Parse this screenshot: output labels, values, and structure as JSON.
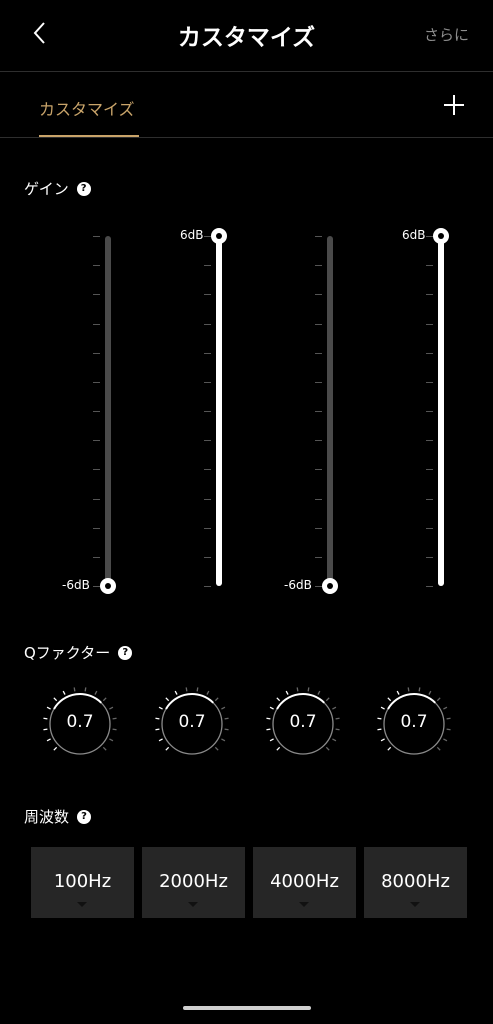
{
  "header": {
    "title": "カスタマイズ",
    "more_label": "さらに",
    "back_icon": "chevron-left-icon"
  },
  "tabs": [
    {
      "label": "カスタマイズ",
      "active": true
    }
  ],
  "colors": {
    "accent": "#c9a46a",
    "background": "#000000",
    "button_bg": "#262626"
  },
  "gain": {
    "label": "ゲイン",
    "max_label": "6dB",
    "min_label": "-6dB",
    "sliders": [
      {
        "value_db": -6
      },
      {
        "value_db": 6
      },
      {
        "value_db": -6
      },
      {
        "value_db": 6
      }
    ]
  },
  "q_factor": {
    "label": "Qファクター",
    "dials": [
      {
        "value": "0.7"
      },
      {
        "value": "0.7"
      },
      {
        "value": "0.7"
      },
      {
        "value": "0.7"
      }
    ]
  },
  "frequency": {
    "label": "周波数",
    "buttons": [
      {
        "label": "100Hz"
      },
      {
        "label": "2000Hz"
      },
      {
        "label": "4000Hz"
      },
      {
        "label": "8000Hz"
      }
    ]
  }
}
